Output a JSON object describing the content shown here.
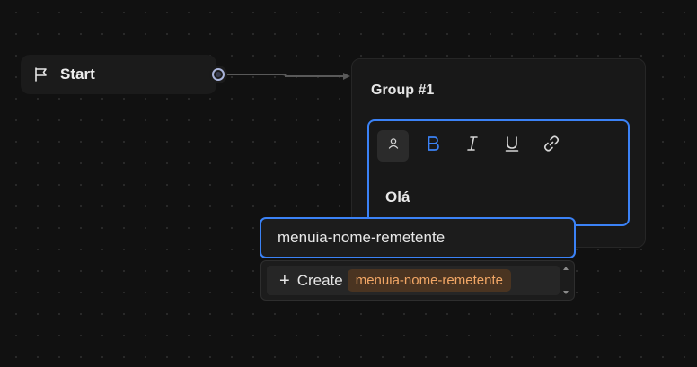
{
  "start_node": {
    "label": "Start",
    "icon": "flag-icon"
  },
  "group_node": {
    "title": "Group #1",
    "editor": {
      "toolbar": [
        {
          "name": "variable-button",
          "icon": "user-icon",
          "active": true
        },
        {
          "name": "bold-button",
          "icon": "bold-icon",
          "active_color": "#3b82f6"
        },
        {
          "name": "italic-button",
          "icon": "italic-icon"
        },
        {
          "name": "underline-button",
          "icon": "underline-icon"
        },
        {
          "name": "link-button",
          "icon": "link-icon"
        }
      ],
      "content": "Olá"
    }
  },
  "variable_search": {
    "value": "menuia-nome-remetente",
    "create_label": "Create",
    "create_value": "menuia-nome-remetente"
  },
  "colors": {
    "accent": "#3b82f6",
    "chip_bg": "#4a3421",
    "chip_text": "#f2a766",
    "canvas": "#111111"
  }
}
